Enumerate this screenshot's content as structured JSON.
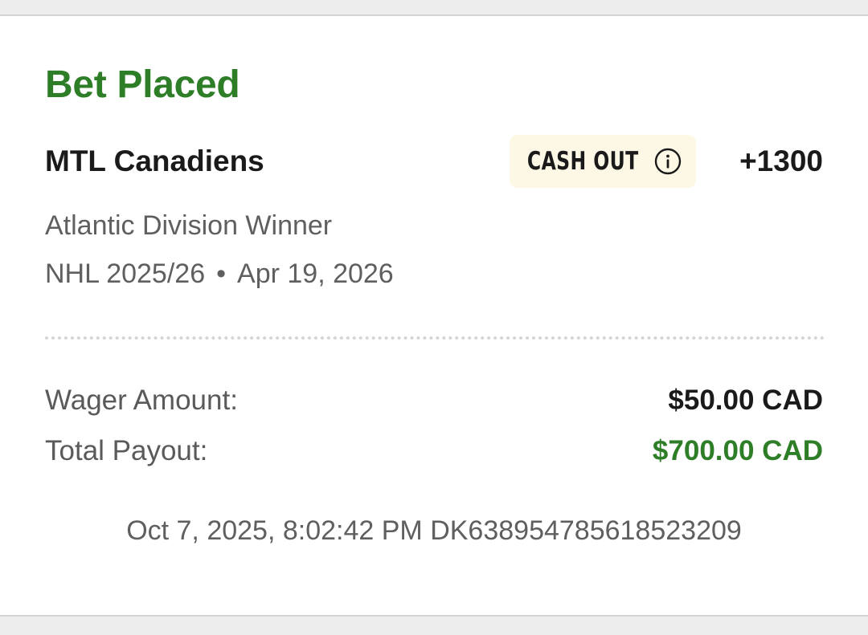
{
  "bet": {
    "status_title": "Bet Placed",
    "selection": "MTL Canadiens",
    "cash_out_label": "CASH OUT",
    "odds": "+1300",
    "market": "Atlantic Division Winner",
    "league": "NHL 2025/26",
    "separator": "•",
    "event_date": "Apr 19, 2026"
  },
  "summary": {
    "wager_label": "Wager Amount:",
    "wager_value": "$50.00 CAD",
    "payout_label": "Total Payout:",
    "payout_value": "$700.00 CAD"
  },
  "footer": {
    "placed_at": "Oct 7, 2025, 8:02:42 PM",
    "bet_id": "DK638954785618523209"
  },
  "icons": {
    "info": "info-circle-icon"
  },
  "colors": {
    "accent_green": "#2e7d27",
    "cash_out_bg": "#fdf8e6",
    "text_primary": "#1a1a1a",
    "text_secondary": "#5f5f5f"
  }
}
